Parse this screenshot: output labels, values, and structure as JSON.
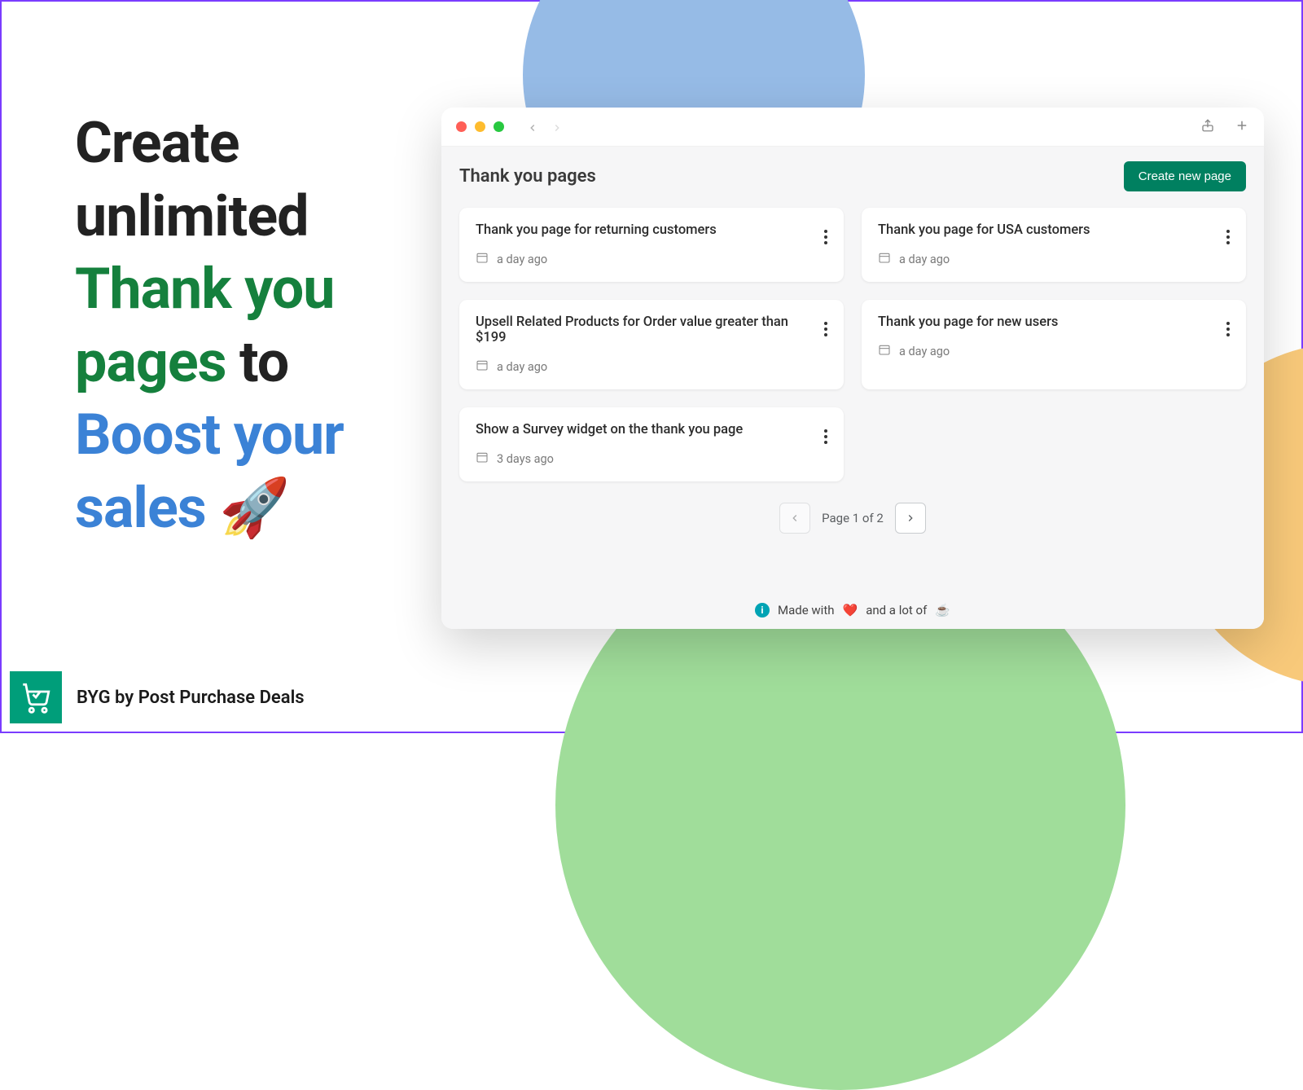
{
  "headline": {
    "part1": "Create unlimited",
    "highlight1": "Thank you pages",
    "part2": "to",
    "highlight2": "Boost your sales",
    "emoji": "🚀"
  },
  "window": {
    "title": "Thank you pages",
    "create_label": "Create new page"
  },
  "cards": [
    {
      "title": "Thank you page for returning customers",
      "time": "a day ago"
    },
    {
      "title": "Thank you page for USA customers",
      "time": "a day ago"
    },
    {
      "title": "Upsell Related Products for Order value greater than $199",
      "time": "a day ago"
    },
    {
      "title": "Thank you page for new users",
      "time": "a day ago"
    },
    {
      "title": "Show a Survey widget on the thank you page",
      "time": "3 days ago"
    }
  ],
  "pagination": {
    "text": "Page 1 of 2"
  },
  "footer": {
    "prefix": "Made with",
    "heart": "❤️",
    "mid": "and a lot of",
    "coffee": "☕"
  },
  "brand": {
    "text": "BYG by Post Purchase Deals"
  }
}
